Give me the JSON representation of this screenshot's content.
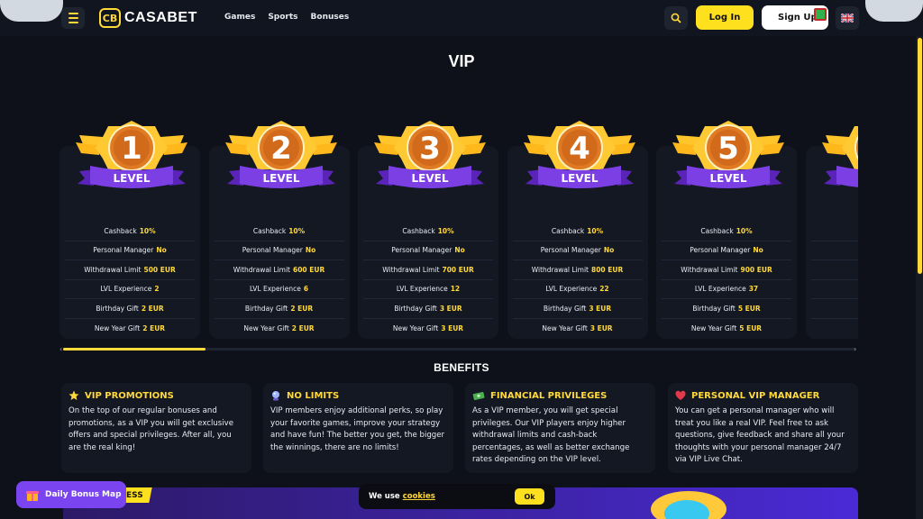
{
  "header": {
    "logo_mark": "CB",
    "logo_text": "CASABET",
    "nav": [
      "Games",
      "Sports",
      "Bonuses"
    ],
    "login_label": "Log In",
    "signup_label": "Sign Up"
  },
  "vip": {
    "title": "VIP",
    "badge_word": "LEVEL",
    "row_labels": [
      "Cashback",
      "Personal Manager",
      "Withdrawal Limit",
      "LVL Experience",
      "Birthday Gift",
      "New Year Gift"
    ],
    "levels": [
      {
        "number": "1",
        "values": [
          "10%",
          "No",
          "500 EUR",
          "2",
          "2 EUR",
          "2 EUR"
        ]
      },
      {
        "number": "2",
        "values": [
          "10%",
          "No",
          "600 EUR",
          "6",
          "2 EUR",
          "2 EUR"
        ]
      },
      {
        "number": "3",
        "values": [
          "10%",
          "No",
          "700 EUR",
          "12",
          "3 EUR",
          "3 EUR"
        ]
      },
      {
        "number": "4",
        "values": [
          "10%",
          "No",
          "800 EUR",
          "22",
          "3 EUR",
          "3 EUR"
        ]
      },
      {
        "number": "5",
        "values": [
          "10%",
          "No",
          "900 EUR",
          "37",
          "5 EUR",
          "5 EUR"
        ]
      }
    ]
  },
  "benefits": {
    "title": "BENEFITS",
    "items": [
      {
        "icon": "star-icon",
        "title": "VIP PROMOTIONS",
        "text": "On the top of our regular bonuses and promotions, as a VIP you will get exclusive offers and special privileges. After all, you are the real king!"
      },
      {
        "icon": "crystal-ball-icon",
        "title": "NO LIMITS",
        "text": "VIP members enjoy additional perks, so play your favorite games, improve your strategy and have fun! The better you get, the bigger the winnings, there are no limits!"
      },
      {
        "icon": "money-icon",
        "title": "FINANCIAL PRIVILEGES",
        "text": "As a VIP member, you will get special privileges. Our VIP players enjoy higher withdrawal limits and cash-back percentages, as well as better exchange rates depending on the VIP level."
      },
      {
        "icon": "heart-icon",
        "title": "PERSONAL VIP MANAGER",
        "text": "You can get a personal manager who will treat you like a real VIP. Feel free to ask questions, give feedback and share all your thoughts with your personal manager 24/7 via VIP Live Chat."
      }
    ]
  },
  "promo": {
    "tag": "ESS"
  },
  "daily": {
    "label": "Daily Bonus Map"
  },
  "cookie": {
    "text": "We use",
    "link": "cookies",
    "ok": "Ok"
  },
  "colors": {
    "accent": "#ffd93a",
    "background": "#0e1119",
    "card": "#141823",
    "badge_purple": "#7b3fe4",
    "badge_orange": "#e8832a"
  }
}
